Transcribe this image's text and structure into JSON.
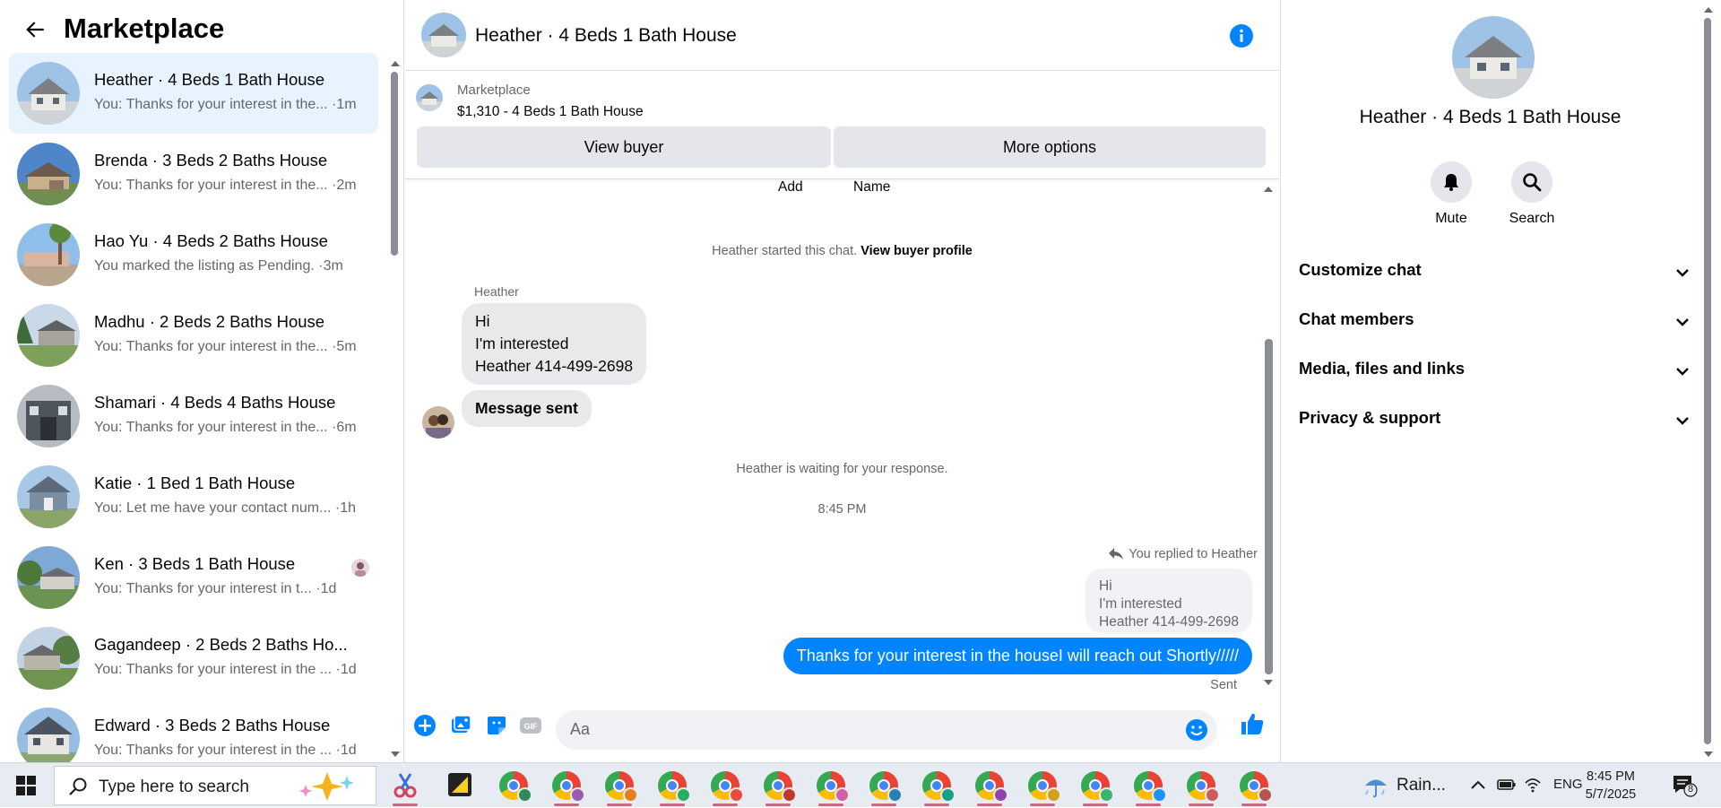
{
  "sidebar": {
    "title": "Marketplace",
    "conversations": [
      {
        "name": "Heather · 4 Beds 1 Bath House",
        "snippet": "You: Thanks for your interest in the... ·1m",
        "active": true
      },
      {
        "name": "Brenda · 3 Beds 2 Baths House",
        "snippet": "You: Thanks for your interest in the... ·2m"
      },
      {
        "name": "Hao Yu · 4 Beds 2 Baths House",
        "snippet": "You marked the listing as Pending. ·3m"
      },
      {
        "name": "Madhu · 2 Beds 2 Baths House",
        "snippet": "You: Thanks for your interest in the... ·5m"
      },
      {
        "name": "Shamari · 4 Beds 4 Baths House",
        "snippet": "You: Thanks for your interest in the... ·6m"
      },
      {
        "name": "Katie · 1 Bed 1 Bath House",
        "snippet": "You: Let me have your contact num... ·1h"
      },
      {
        "name": "Ken · 3 Beds 1 Bath House",
        "snippet": "You: Thanks for your interest in t... ·1d"
      },
      {
        "name": "Gagandeep · 2 Beds 2 Baths Ho...",
        "snippet": "You: Thanks for your interest in the ... ·1d"
      },
      {
        "name": "Edward · 3 Beds 2 Baths House",
        "snippet": "You: Thanks for your interest in the ... ·1d"
      }
    ]
  },
  "chat": {
    "title": "Heather · 4 Beds 1 Bath House",
    "listing_source": "Marketplace",
    "listing_price": "$1,310 - 4 Beds 1 Bath House",
    "view_buyer_label": "View buyer",
    "more_options_label": "More options",
    "partial_add": "Add",
    "partial_name": "Name",
    "started_text": "Heather started this chat.",
    "view_profile_link": "View buyer profile",
    "sender_name": "Heather",
    "incoming_lines": [
      "Hi",
      "I'm interested",
      "Heather 414-499-2698"
    ],
    "incoming_status": "Message sent",
    "waiting_text": "Heather is waiting for your response.",
    "timestamp": "8:45 PM",
    "reply_label": "You replied to Heather",
    "quote_lines": [
      "Hi",
      "I'm interested",
      "Heather 414-499-2698"
    ],
    "outgoing_text": "Thanks for your interest in the houseI will reach out Shortly/////",
    "sent_label": "Sent",
    "composer_placeholder": "Aa"
  },
  "right_panel": {
    "name": "Heather · 4 Beds 1 Bath House",
    "mute_label": "Mute",
    "search_label": "Search",
    "sections": [
      "Customize chat",
      "Chat members",
      "Media, files and links",
      "Privacy & support"
    ]
  },
  "taskbar": {
    "search_placeholder": "Type here to search",
    "weather_text": "Rain...",
    "language": "ENG",
    "time": "8:45 PM",
    "date": "5/7/2025",
    "notification_count": "8"
  },
  "colors": {
    "accent": "#0084ff",
    "active_row": "#e7f3ff",
    "button_gray": "#e4e6eb",
    "bubble_gray": "#e9e9eb"
  }
}
